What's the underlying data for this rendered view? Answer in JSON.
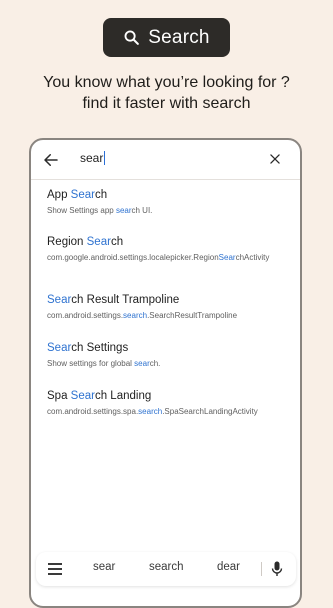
{
  "header": {
    "badge_label": "Search",
    "tagline_line1": "You know what you’re looking for ?",
    "tagline_line2": "find it faster with search"
  },
  "searchbar": {
    "query": "sear"
  },
  "results": [
    {
      "title_pre": "App ",
      "title_hl": "Sear",
      "title_post": "ch",
      "sub_pre": "Show Settings app ",
      "sub_hl": "sear",
      "sub_post": "ch UI."
    },
    {
      "title_pre": "Region ",
      "title_hl": "Sear",
      "title_post": "ch",
      "sub_pre": "com.google.android.settings.localepicker.Region",
      "sub_hl": "Sear",
      "sub_post": "chActivity"
    },
    {
      "title_pre": "",
      "title_hl": "Sear",
      "title_post": "ch Result Trampoline",
      "sub_pre": "com.android.settings.",
      "sub_hl": "search",
      "sub_post": ".SearchResultTrampoline"
    },
    {
      "title_pre": "",
      "title_hl": "Sear",
      "title_post": "ch Settings",
      "sub_pre": "Show settings for global ",
      "sub_hl": "sear",
      "sub_post": "ch."
    },
    {
      "title_pre": "Spa ",
      "title_hl": "Sear",
      "title_post": "ch Landing",
      "sub_pre": "com.android.settings.spa.",
      "sub_hl": "search",
      "sub_post": ".SpaSearchLandingActivity"
    }
  ],
  "keyboard": {
    "suggestions": [
      "sear",
      "search",
      "dear"
    ]
  },
  "colors": {
    "background": "#f9efe6",
    "badge": "#2d2b28",
    "highlight": "#2f73d0"
  },
  "icons": {
    "badge": "search-icon",
    "back": "arrow-back-icon",
    "clear": "close-icon",
    "keyboard_menu": "menu-icon",
    "keyboard_mic": "mic-icon"
  }
}
